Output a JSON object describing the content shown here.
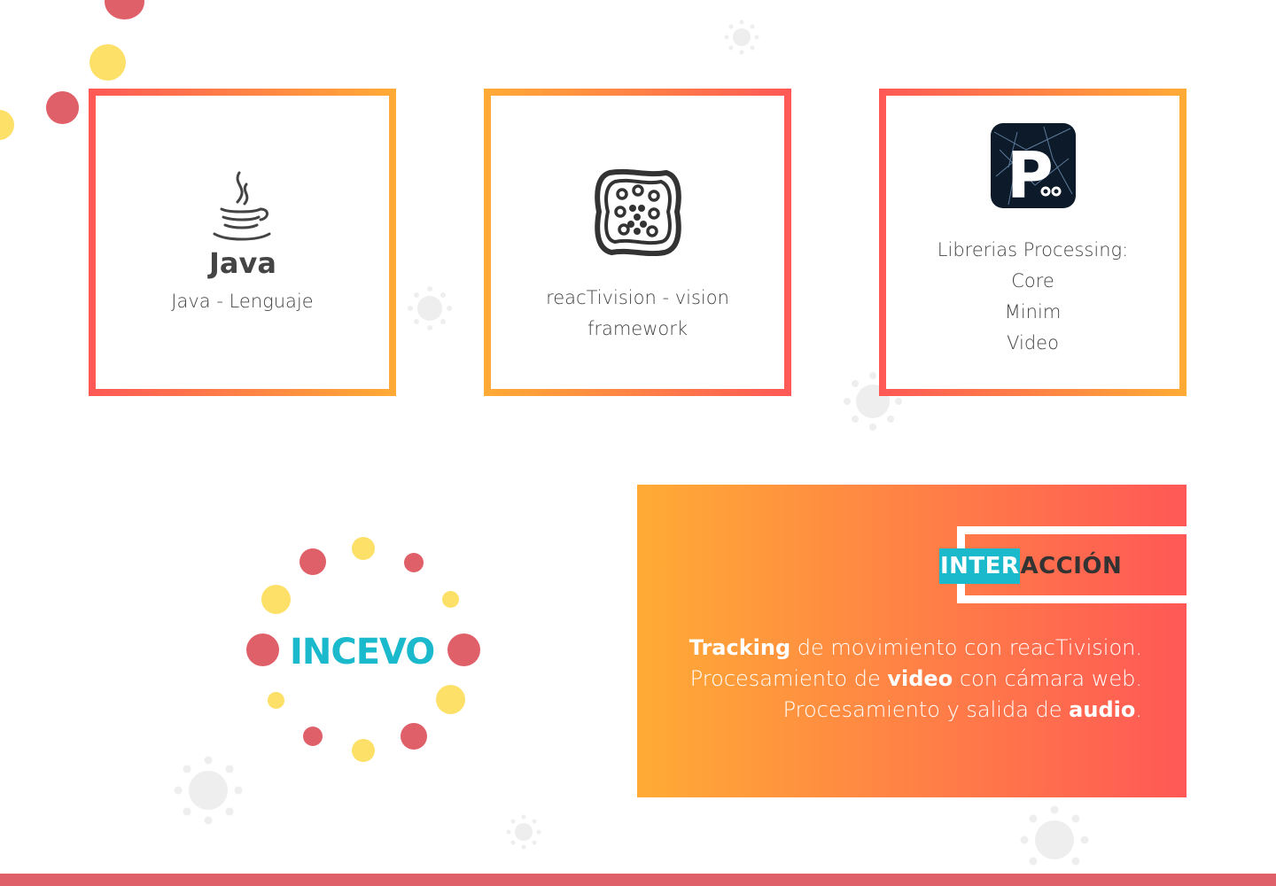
{
  "cards": [
    {
      "logo": "java-logo",
      "logo_text": "Java",
      "lines": [
        "Java - Lenguaje"
      ]
    },
    {
      "logo": "reactivision-fiducial-icon",
      "lines": [
        "reacTivision - vision",
        "framework"
      ]
    },
    {
      "logo": "processing-logo",
      "logo_text": "P",
      "lines": [
        "Librerias Processing:",
        "Core",
        "Minim",
        "Video"
      ]
    }
  ],
  "brand": {
    "name": "INCEVO"
  },
  "interaction": {
    "title_highlight": "INTER",
    "title_rest": "ACCIÓN",
    "line1": {
      "bold": "Tracking",
      "rest": " de movimiento con reacTivision."
    },
    "line2": {
      "pre": "Procesamiento de ",
      "bold": "video",
      "post": " con cámara web."
    },
    "line3": {
      "pre": "Procesamiento y salida de ",
      "bold": "audio",
      "post": "."
    }
  },
  "colors": {
    "accent_red": "#e0606a",
    "accent_yellow": "#fde068",
    "accent_cyan": "#1ab9cc",
    "gradient_orange": "#ffab35",
    "gradient_red": "#ff5856"
  }
}
